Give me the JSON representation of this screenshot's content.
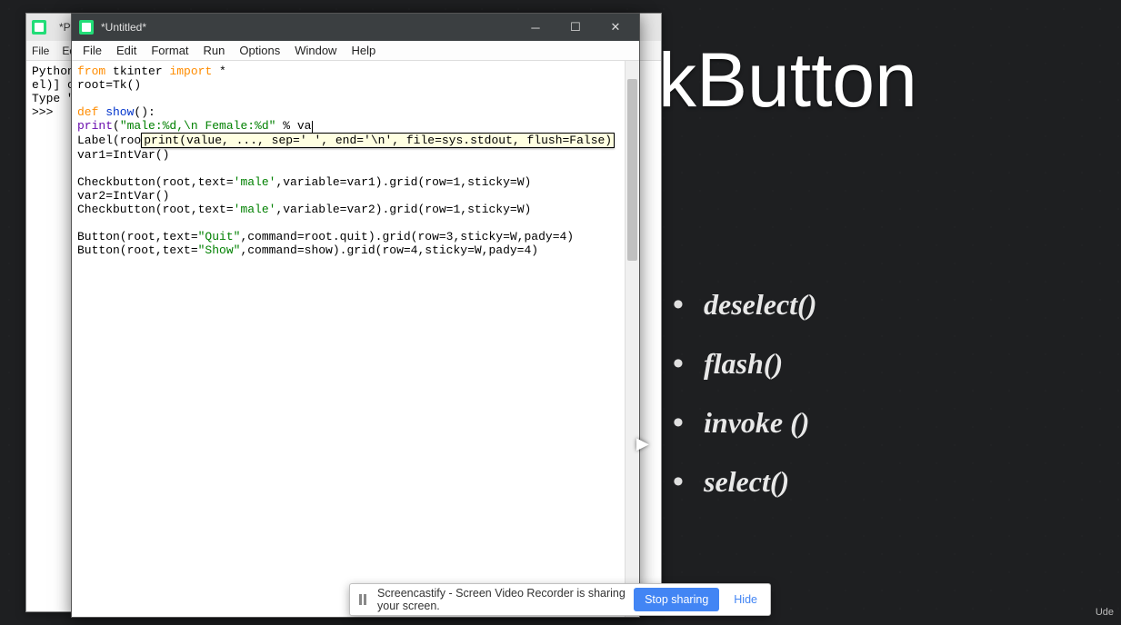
{
  "back_window": {
    "title": "*Pyt",
    "menu": [
      "File",
      "Ed"
    ],
    "lines": [
      "Python",
      "el)] c",
      "Type \"",
      ">>> "
    ]
  },
  "editor": {
    "title": "*Untitled*",
    "menu": [
      "File",
      "Edit",
      "Format",
      "Run",
      "Options",
      "Window",
      "Help"
    ],
    "code": {
      "l1_from": "from",
      "l1_rest": " tkinter ",
      "l1_import": "import",
      "l1_star": " *",
      "l2": "root=Tk()",
      "l3": "",
      "l4_def": "def",
      "l4_name": " show",
      "l4_rest": "():",
      "l5_indent": "    ",
      "l5_print": "print",
      "l5_open": "(",
      "l5_str": "\"male:%d,\\n Female:%d\"",
      "l5_mid": " % va",
      "l6_pre": "Label(roo",
      "l6_tip": "print(value, ..., sep=' ', end='\\n', file=sys.stdout, flush=False)",
      "l7": "var1=IntVar()",
      "l8": "",
      "l9a": "Checkbutton(root,text=",
      "l9s": "'male'",
      "l9b": ",variable=var1).grid(row=1,sticky=W)",
      "l10": "var2=IntVar()",
      "l11a": "Checkbutton(root,text=",
      "l11s": "'male'",
      "l11b": ",variable=var2).grid(row=1,sticky=W)",
      "l12": "",
      "l13a": "Button(root,text=",
      "l13s": "\"Quit\"",
      "l13b": ",command=root.quit).grid(row=3,sticky=W,pady=4)",
      "l14a": "Button(root,text=",
      "l14s": "\"Show\"",
      "l14b": ",command=show).grid(row=4,sticky=W,pady=4)"
    }
  },
  "slide": {
    "title": "kButton",
    "items": [
      "deselect()",
      "flash()",
      "invoke ()",
      "select()"
    ]
  },
  "share": {
    "text": "Screencastify - Screen Video Recorder is sharing your screen.",
    "stop": "Stop sharing",
    "hide": "Hide"
  },
  "brand": "Ude"
}
